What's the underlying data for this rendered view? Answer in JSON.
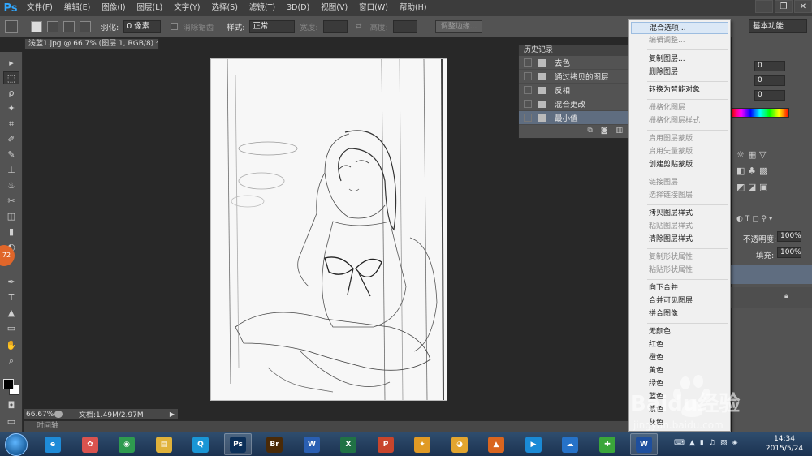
{
  "app": {
    "logo": "Ps"
  },
  "menubar": {
    "items": [
      "文件(F)",
      "编辑(E)",
      "图像(I)",
      "图层(L)",
      "文字(Y)",
      "选择(S)",
      "滤镜(T)",
      "3D(D)",
      "视图(V)",
      "窗口(W)",
      "帮助(H)"
    ],
    "window_controls": [
      "─",
      "❐",
      "✕"
    ]
  },
  "options": {
    "feather_label": "羽化:",
    "feather_value": "0 像素",
    "antialias_label": "消除锯齿",
    "style_label": "样式:",
    "style_value": "正常",
    "width_label": "宽度:",
    "height_label": "高度:",
    "refine_button": "调整边缘...",
    "workspace": "基本功能"
  },
  "document": {
    "tab_title": "浅蓝1.jpg @ 66.7% (图层 1, RGB/8) *",
    "zoom": "66.67%",
    "doc_size": "文档:1.49M/2.97M",
    "timeline_label": "时间轴"
  },
  "tools": {
    "badge_value": "72",
    "glyphs": [
      "▸",
      "⬚",
      "ρ",
      "✦",
      "⌗",
      "✐",
      "✎",
      "⊥",
      "♨",
      "✂",
      "◫",
      "▮",
      "◐",
      "✒",
      "T",
      "▲",
      "▭",
      "✋",
      "⌕"
    ]
  },
  "history": {
    "title": "历史记录",
    "items": [
      {
        "label": "去色",
        "selected": false
      },
      {
        "label": "通过拷贝的图层",
        "selected": false
      },
      {
        "label": "反相",
        "selected": false
      },
      {
        "label": "混合更改",
        "selected": false
      },
      {
        "label": "最小值",
        "selected": true
      }
    ]
  },
  "color_panel": {
    "r": "0",
    "g": "0",
    "b": "0",
    "red": "#e23b3b",
    "green": "#35c24a",
    "blue": "#2c54e6"
  },
  "layers": {
    "opacity_label": "不透明度:",
    "opacity_value": "100%",
    "fill_label": "填充:",
    "fill_value": "100%"
  },
  "context_menu": {
    "items": [
      {
        "label": "混合选项...",
        "disabled": false,
        "highlight": true
      },
      {
        "label": "编辑调整...",
        "disabled": true
      },
      {
        "label": "复制图层...",
        "disabled": false
      },
      {
        "label": "删除图层",
        "disabled": false
      },
      {
        "label": "转换为智能对象",
        "disabled": false
      },
      {
        "label": "栅格化图层",
        "disabled": true
      },
      {
        "label": "栅格化图层样式",
        "disabled": true
      },
      {
        "label": "启用图层蒙版",
        "disabled": true
      },
      {
        "label": "启用矢量蒙版",
        "disabled": true
      },
      {
        "label": "创建剪贴蒙版",
        "disabled": false
      },
      {
        "label": "链接图层",
        "disabled": true
      },
      {
        "label": "选择链接图层",
        "disabled": true
      },
      {
        "label": "拷贝图层样式",
        "disabled": false
      },
      {
        "label": "粘贴图层样式",
        "disabled": true
      },
      {
        "label": "清除图层样式",
        "disabled": false
      },
      {
        "label": "复制形状属性",
        "disabled": true
      },
      {
        "label": "粘贴形状属性",
        "disabled": true
      },
      {
        "label": "向下合并",
        "disabled": false
      },
      {
        "label": "合并可见图层",
        "disabled": false
      },
      {
        "label": "拼合图像",
        "disabled": false
      },
      {
        "label": "无颜色",
        "disabled": false
      },
      {
        "label": "红色",
        "disabled": false
      },
      {
        "label": "橙色",
        "disabled": false
      },
      {
        "label": "黄色",
        "disabled": false
      },
      {
        "label": "绿色",
        "disabled": false
      },
      {
        "label": "蓝色",
        "disabled": false
      },
      {
        "label": "紫色",
        "disabled": false
      },
      {
        "label": "灰色",
        "disabled": false
      }
    ]
  },
  "watermark": {
    "text": "Baidu经验",
    "url": "jingyan.baidu.com"
  },
  "taskbar": {
    "apps": [
      {
        "name": "ie",
        "glyph": "e",
        "color": "#1e8bd8",
        "open": false
      },
      {
        "name": "pinwheel",
        "glyph": "✿",
        "color": "#d9534f",
        "open": false
      },
      {
        "name": "chrome",
        "glyph": "◉",
        "color": "#2e9b4f",
        "open": false
      },
      {
        "name": "explorer",
        "glyph": "▤",
        "color": "#e0b23a",
        "open": false
      },
      {
        "name": "qq-player",
        "glyph": "Q",
        "color": "#1a96d6",
        "open": false
      },
      {
        "name": "photoshop",
        "glyph": "Ps",
        "color": "#0b2f58",
        "open": true
      },
      {
        "name": "bridge",
        "glyph": "Br",
        "color": "#4a2a07",
        "open": false
      },
      {
        "name": "word",
        "glyph": "W",
        "color": "#2a5fb3",
        "open": false
      },
      {
        "name": "excel",
        "glyph": "X",
        "color": "#207245",
        "open": false
      },
      {
        "name": "powerpoint",
        "glyph": "P",
        "color": "#c8452c",
        "open": false
      },
      {
        "name": "bird-app",
        "glyph": "✦",
        "color": "#e09a25",
        "open": false
      },
      {
        "name": "paint",
        "glyph": "◕",
        "color": "#e2a52f",
        "open": false
      },
      {
        "name": "matlab",
        "glyph": "▲",
        "color": "#d9651f",
        "open": false
      },
      {
        "name": "media",
        "glyph": "▶",
        "color": "#1a8ad6",
        "open": false
      },
      {
        "name": "cloud",
        "glyph": "☁",
        "color": "#2672c8",
        "open": false
      },
      {
        "name": "security",
        "glyph": "✚",
        "color": "#3aa63a",
        "open": false
      },
      {
        "name": "word-doc",
        "glyph": "W",
        "color": "#1e4f9e",
        "open": true
      }
    ],
    "time": "14:34",
    "date": "2015/5/24",
    "tray_icons": [
      "⌨",
      "▲",
      "▮",
      "♫",
      "▨",
      "◈"
    ]
  }
}
